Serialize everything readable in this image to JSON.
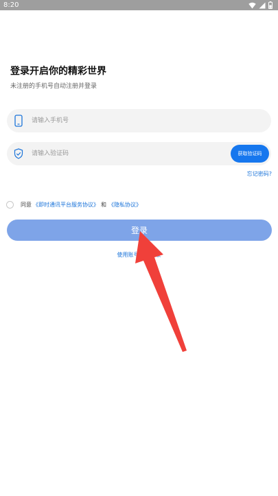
{
  "status_bar": {
    "time": "8:20"
  },
  "header": {
    "title": "登录开启你的精彩世界",
    "subtitle": "未注册的手机号自动注册并登录"
  },
  "form": {
    "phone": {
      "placeholder": "请输入手机号",
      "value": "",
      "icon": "phone-icon"
    },
    "code": {
      "placeholder": "请输入验证码",
      "value": "",
      "icon": "shield-check-icon",
      "get_code_label": "获取验证码"
    },
    "forgot_password": "忘记密码?",
    "agreement": {
      "prefix": "同意",
      "service_link": "《即时通讯平台服务协议》",
      "and": "和",
      "privacy_link": "《隐私协议》",
      "checked": false
    },
    "login_label": "登录",
    "alt_login_label": "使用账号密码登录"
  },
  "colors": {
    "status_bar": "#9e9e9e",
    "accent": "#1677ee",
    "link": "#1a73d9",
    "login_button": "#7ea4e8",
    "field_bg": "#f3f3f3",
    "annotation_arrow": "#f0403a"
  }
}
